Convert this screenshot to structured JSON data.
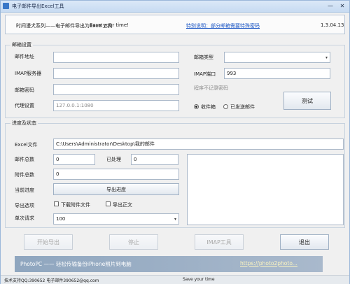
{
  "window": {
    "title": "电子邮件导出Excel工具",
    "min": "—",
    "close": "✕"
  },
  "header": {
    "series": "时间漫犬系列——电子邮件导出为Excel工具",
    "save_time": "Save your time!",
    "link": "特别说明：部分邮箱需要特殊密码",
    "version": "1.3.04.13"
  },
  "mail_settings": {
    "legend": "邮箱设置",
    "address_label": "邮件地址",
    "address_value": "",
    "imap_server_label": "IMAP服务器",
    "imap_server_value": "",
    "password_label": "邮箱密码",
    "password_value": "",
    "proxy_label": "代理设置",
    "proxy_value": "127.0.0.1:1080",
    "type_label": "邮箱类型",
    "type_value": "",
    "imap_port_label": "IMAP端口",
    "imap_port_value": "993",
    "hint": "程序不记录密码",
    "radio_inbox": "收件箱",
    "radio_sent": "已发送邮件",
    "test_button": "测试"
  },
  "progress": {
    "legend": "进度及状态",
    "excel_label": "Excel文件",
    "excel_value": "C:\\Users\\Administrator\\Desktop\\我的邮件",
    "total_label": "邮件总数",
    "total_value": "0",
    "processed_label": "已处理",
    "processed_value": "0",
    "attach_label": "附件总数",
    "attach_value": "0",
    "current_label": "当前进度",
    "export_progress_button": "导出进度",
    "options_label": "导出选项",
    "opt_download_attach": "下载附件文件",
    "opt_export_body": "导出正文",
    "requests_label": "单次请求",
    "requests_value": "100"
  },
  "actions": {
    "start": "开始导出",
    "stop": "停止",
    "imap_tool": "IMAP工具",
    "exit": "退出"
  },
  "banner": {
    "text": "PhotoPC —— 轻松传输备份iPhone照片到电脑",
    "link": "https://photo2photo..."
  },
  "statusbar": {
    "support": "技术支持QQ:390652  电子邮件390652@qq.com",
    "save_time": "Save your time"
  }
}
